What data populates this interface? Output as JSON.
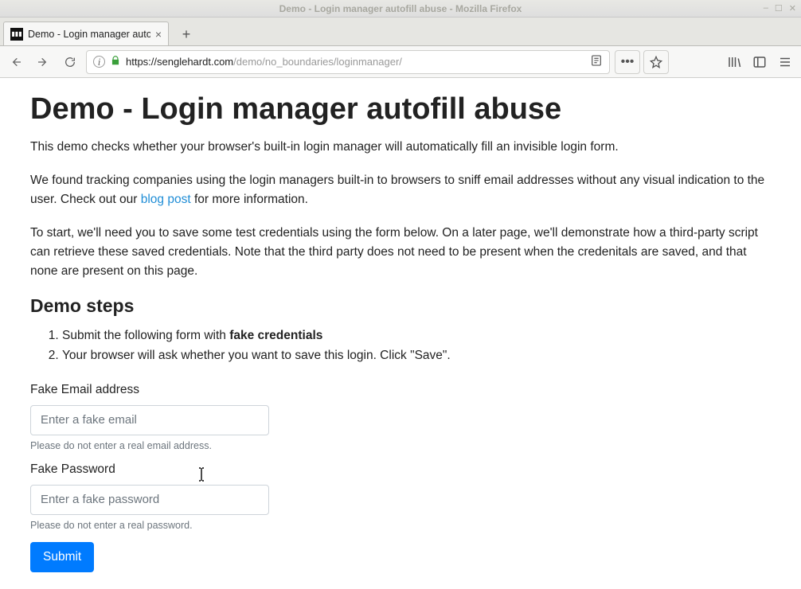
{
  "window": {
    "title": "Demo - Login manager autofill abuse - Mozilla Firefox",
    "controls": {
      "min": "–",
      "max": "☐",
      "close": "✕"
    }
  },
  "tab": {
    "label": "Demo - Login manager autofi",
    "close": "×"
  },
  "url": {
    "scheme_host": "https://senglehardt.com",
    "path": "/demo/no_boundaries/loginmanager/"
  },
  "toolbar_icons": {
    "back": "back-icon",
    "forward": "forward-icon",
    "reload": "reload-icon",
    "info": "i",
    "lock": "lock-icon",
    "reader": "reader-icon",
    "more": "•••",
    "star": "star-icon",
    "library": "library-icon",
    "sidebar": "sidebar-icon",
    "menu": "menu-icon",
    "newtab": "+"
  },
  "page": {
    "heading": "Demo - Login manager autofill abuse",
    "intro1": "This demo checks whether your browser's built-in login manager will automatically fill an invisible login form.",
    "intro2_pre": "We found tracking companies using the login managers built-in to browsers to sniff email addresses without any visual indication to the user. Check out our ",
    "intro2_link": "blog post",
    "intro2_post": " for more information.",
    "intro3": "To start, we'll need you to save some test credentials using the form below. On a later page, we'll demonstrate how a third-party script can retrieve these saved credentials. Note that the third party does not need to be present when the credenitals are saved, and that none are present on this page.",
    "steps_heading": "Demo steps",
    "step1_pre": "Submit the following form with ",
    "step1_bold": "fake credentials",
    "step2": "Your browser will ask whether you want to save this login. Click \"Save\".",
    "email_label": "Fake Email address",
    "email_placeholder": "Enter a fake email",
    "email_help": "Please do not enter a real email address.",
    "password_label": "Fake Password",
    "password_placeholder": "Enter a fake password",
    "password_help": "Please do not enter a real password.",
    "submit_label": "Submit"
  }
}
